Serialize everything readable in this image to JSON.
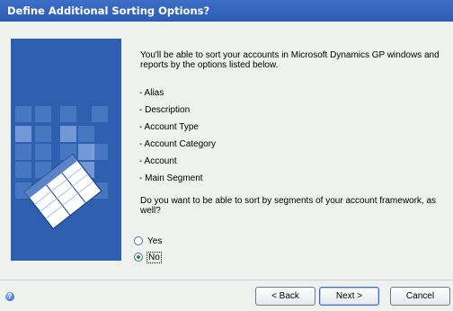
{
  "window": {
    "title": "Define Additional Sorting Options?"
  },
  "content": {
    "intro": "You'll be able to sort your accounts in Microsoft Dynamics GP windows and reports by the options listed below.",
    "options": [
      "- Alias",
      "- Description",
      "- Account Type",
      "- Account Category",
      "- Account",
      "- Main Segment"
    ],
    "question": "Do you want to be able to sort by segments of your account framework, as well?",
    "radios": {
      "yes": {
        "label": "Yes",
        "selected": false
      },
      "no": {
        "label": "No",
        "selected": true
      }
    }
  },
  "footer": {
    "help_icon": "help-icon",
    "back_label": "< Back",
    "next_label": "Next >",
    "cancel_label": "Cancel"
  },
  "colors": {
    "titlebar": "#3366cc",
    "panel": "#eef1ee",
    "art_background": "#2858a8"
  }
}
